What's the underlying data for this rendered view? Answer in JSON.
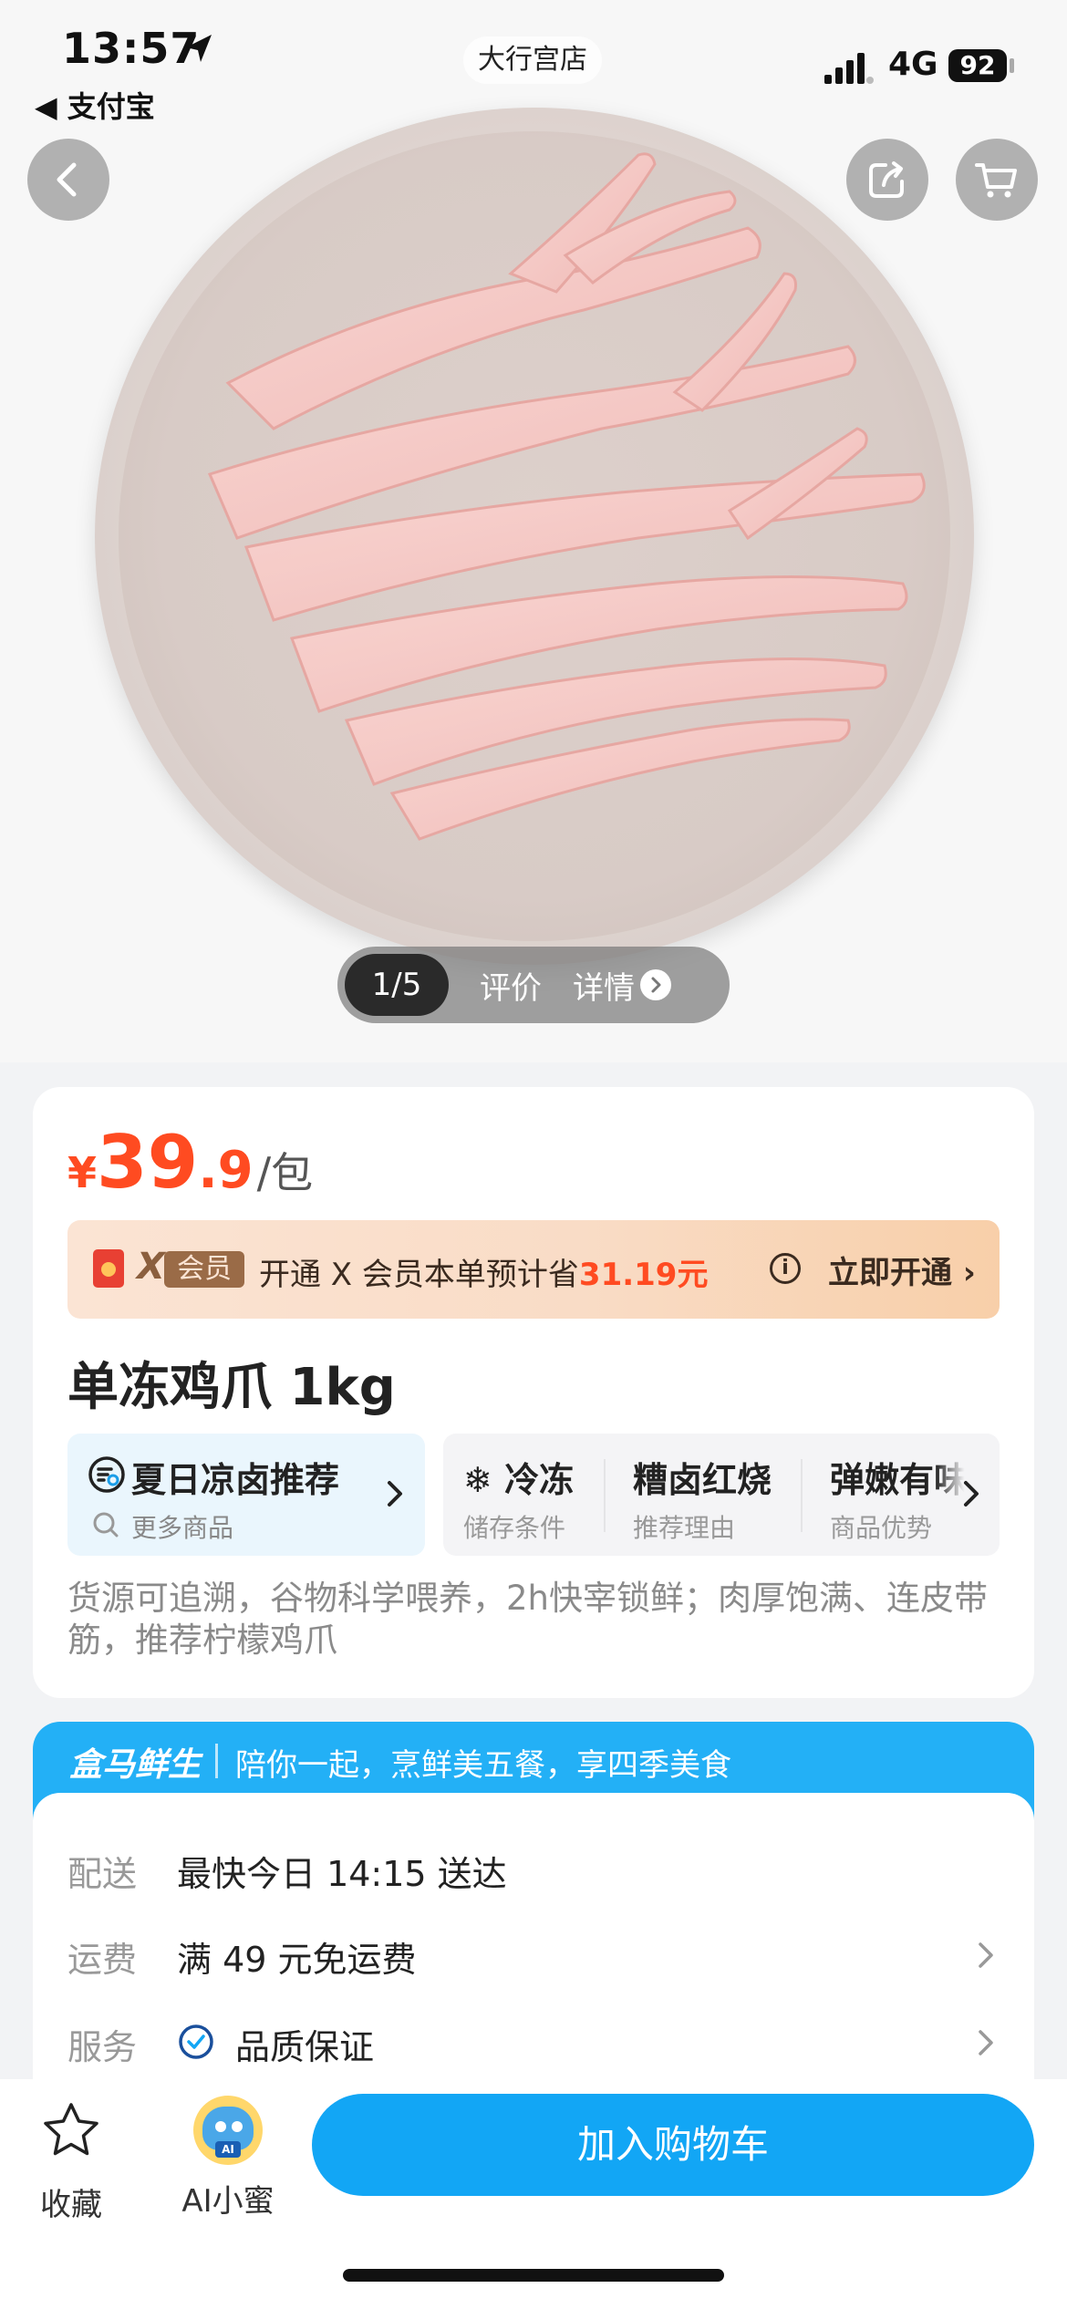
{
  "status_bar": {
    "time": "13:57",
    "back_app": "◀ 支付宝",
    "network": "4G",
    "battery": "92"
  },
  "store": {
    "name": "大行宫店"
  },
  "gallery": {
    "counter": "1/5",
    "tab_reviews": "评价",
    "tab_details": "详情"
  },
  "product": {
    "price": {
      "currency": "¥",
      "integer": "39",
      "decimal": ".9",
      "unit": "/包"
    },
    "title": "单冻鸡爪 1kg",
    "description": "货源可追溯，谷物科学喂养，2h快宰锁鲜；肉厚饱满、连皮带筋，推荐柠檬鸡爪"
  },
  "vip": {
    "logo_x": "X",
    "logo_tag": "会员",
    "text_prefix": "开通 X 会员本单预计省",
    "save_amount": "31.19元",
    "info_glyph": "i",
    "cta": "立即开通 ›"
  },
  "recommend": {
    "title": "夏日凉卤推荐",
    "subtitle": "更多商品"
  },
  "attributes": [
    {
      "value": "❄ 冷冻",
      "key": "储存条件"
    },
    {
      "value": "糟卤红烧",
      "key": "推荐理由"
    },
    {
      "value": "弹嫩有味",
      "key": "商品优势"
    }
  ],
  "service": {
    "brand": "盒马鲜生",
    "slogan": "陪你一起，烹鲜美五餐，享四季美食",
    "rows": [
      {
        "key": "配送",
        "value": "最快今日 14:15 送达"
      },
      {
        "key": "运费",
        "value": "满 49 元免运费"
      },
      {
        "key": "服务",
        "value": "品质保证"
      }
    ]
  },
  "bottom_bar": {
    "favorite_label": "收藏",
    "ai_label": "AI小蜜",
    "ai_badge": "AI",
    "add_to_cart": "加入购物车"
  },
  "colors": {
    "price": "#ff4b21",
    "primary_button": "#12a6f5",
    "service_header": "#23b0f6"
  }
}
